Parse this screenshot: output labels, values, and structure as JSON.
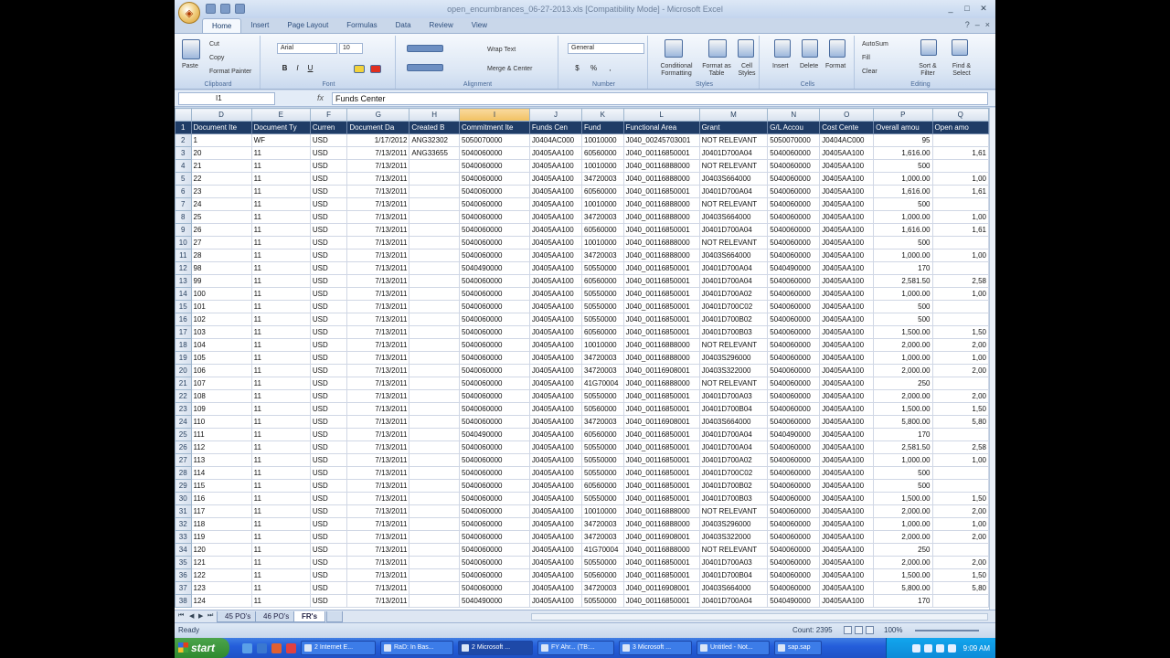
{
  "window": {
    "title": "open_encumbrances_06-27-2013.xls [Compatibility Mode] - Microsoft Excel",
    "controls": [
      "_",
      "□",
      "✕"
    ]
  },
  "ribbon_tabs": [
    "Home",
    "Insert",
    "Page Layout",
    "Formulas",
    "Data",
    "Review",
    "View"
  ],
  "ribbon": {
    "clipboard": {
      "paste": "Paste",
      "cut": "Cut",
      "copy": "Copy",
      "format_painter": "Format Painter",
      "label": "Clipboard"
    },
    "font": {
      "name": "Arial",
      "size": "10",
      "label": "Font"
    },
    "alignment": {
      "wrap": "Wrap Text",
      "merge": "Merge & Center",
      "label": "Alignment"
    },
    "number": {
      "format": "General",
      "label": "Number"
    },
    "styles": {
      "conditional": "Conditional Formatting",
      "format_table": "Format as Table",
      "cell_styles": "Cell Styles",
      "label": "Styles"
    },
    "cells": {
      "insert": "Insert",
      "delete": "Delete",
      "format": "Format",
      "label": "Cells"
    },
    "editing": {
      "autosum": "AutoSum",
      "fill": "Fill",
      "clear": "Clear",
      "sort": "Sort & Filter",
      "find": "Find & Select",
      "label": "Editing"
    }
  },
  "formula_bar": {
    "name_box": "I1",
    "fx": "fx",
    "content": "Funds Center"
  },
  "columns": [
    "D",
    "E",
    "F",
    "G",
    "H",
    "I",
    "J",
    "K",
    "L",
    "M",
    "N",
    "O",
    "P",
    "Q"
  ],
  "header_row": [
    "Document Ite",
    "Document Ty",
    "Curren",
    "Document Da",
    "Created B",
    "Commitment Ite",
    "Funds Cen",
    "Fund",
    "Functional Area",
    "Grant",
    "G/L Accou",
    "Cost Cente",
    "Overall amou",
    "Open amo"
  ],
  "rows": [
    {
      "r": "2",
      "c": [
        "1",
        "WF",
        "USD",
        "1/17/2012",
        "ANG32302",
        "5050070000",
        "J0404AC000",
        "10010000",
        "J040_00245703001",
        "NOT RELEVANT",
        "5050070000",
        "J0404AC000",
        "95",
        ""
      ]
    },
    {
      "r": "3",
      "c": [
        "20",
        "11",
        "USD",
        "7/13/2011",
        "ANG33655",
        "5040060000",
        "J0405AA100",
        "60560000",
        "J040_00116850001",
        "J0401D700A04",
        "5040060000",
        "J0405AA100",
        "1,616.00",
        "1,61"
      ]
    },
    {
      "r": "4",
      "c": [
        "21",
        "11",
        "USD",
        "7/13/2011",
        "",
        "5040060000",
        "J0405AA100",
        "10010000",
        "J040_00116888000",
        "NOT RELEVANT",
        "5040060000",
        "J0405AA100",
        "500",
        ""
      ]
    },
    {
      "r": "5",
      "c": [
        "22",
        "11",
        "USD",
        "7/13/2011",
        "",
        "5040060000",
        "J0405AA100",
        "34720003",
        "J040_00116888000",
        "J0403S664000",
        "5040060000",
        "J0405AA100",
        "1,000.00",
        "1,00"
      ]
    },
    {
      "r": "6",
      "c": [
        "23",
        "11",
        "USD",
        "7/13/2011",
        "",
        "5040060000",
        "J0405AA100",
        "60560000",
        "J040_00116850001",
        "J0401D700A04",
        "5040060000",
        "J0405AA100",
        "1,616.00",
        "1,61"
      ]
    },
    {
      "r": "7",
      "c": [
        "24",
        "11",
        "USD",
        "7/13/2011",
        "",
        "5040060000",
        "J0405AA100",
        "10010000",
        "J040_00116888000",
        "NOT RELEVANT",
        "5040060000",
        "J0405AA100",
        "500",
        ""
      ]
    },
    {
      "r": "8",
      "c": [
        "25",
        "11",
        "USD",
        "7/13/2011",
        "",
        "5040060000",
        "J0405AA100",
        "34720003",
        "J040_00116888000",
        "J0403S664000",
        "5040060000",
        "J0405AA100",
        "1,000.00",
        "1,00"
      ]
    },
    {
      "r": "9",
      "c": [
        "26",
        "11",
        "USD",
        "7/13/2011",
        "",
        "5040060000",
        "J0405AA100",
        "60560000",
        "J040_00116850001",
        "J0401D700A04",
        "5040060000",
        "J0405AA100",
        "1,616.00",
        "1,61"
      ]
    },
    {
      "r": "10",
      "c": [
        "27",
        "11",
        "USD",
        "7/13/2011",
        "",
        "5040060000",
        "J0405AA100",
        "10010000",
        "J040_00116888000",
        "NOT RELEVANT",
        "5040060000",
        "J0405AA100",
        "500",
        ""
      ]
    },
    {
      "r": "11",
      "c": [
        "28",
        "11",
        "USD",
        "7/13/2011",
        "",
        "5040060000",
        "J0405AA100",
        "34720003",
        "J040_00116888000",
        "J0403S664000",
        "5040060000",
        "J0405AA100",
        "1,000.00",
        "1,00"
      ]
    },
    {
      "r": "12",
      "c": [
        "98",
        "11",
        "USD",
        "7/13/2011",
        "",
        "5040490000",
        "J0405AA100",
        "50550000",
        "J040_00116850001",
        "J0401D700A04",
        "5040490000",
        "J0405AA100",
        "170",
        ""
      ]
    },
    {
      "r": "13",
      "c": [
        "99",
        "11",
        "USD",
        "7/13/2011",
        "",
        "5040060000",
        "J0405AA100",
        "60560000",
        "J040_00116850001",
        "J0401D700A04",
        "5040060000",
        "J0405AA100",
        "2,581.50",
        "2,58"
      ]
    },
    {
      "r": "14",
      "c": [
        "100",
        "11",
        "USD",
        "7/13/2011",
        "",
        "5040060000",
        "J0405AA100",
        "50550000",
        "J040_00116850001",
        "J0401D700A02",
        "5040060000",
        "J0405AA100",
        "1,000.00",
        "1,00"
      ]
    },
    {
      "r": "15",
      "c": [
        "101",
        "11",
        "USD",
        "7/13/2011",
        "",
        "5040060000",
        "J0405AA100",
        "50550000",
        "J040_00116850001",
        "J0401D700C02",
        "5040060000",
        "J0405AA100",
        "500",
        ""
      ]
    },
    {
      "r": "16",
      "c": [
        "102",
        "11",
        "USD",
        "7/13/2011",
        "",
        "5040060000",
        "J0405AA100",
        "50550000",
        "J040_00116850001",
        "J0401D700B02",
        "5040060000",
        "J0405AA100",
        "500",
        ""
      ]
    },
    {
      "r": "17",
      "c": [
        "103",
        "11",
        "USD",
        "7/13/2011",
        "",
        "5040060000",
        "J0405AA100",
        "60560000",
        "J040_00116850001",
        "J0401D700B03",
        "5040060000",
        "J0405AA100",
        "1,500.00",
        "1,50"
      ]
    },
    {
      "r": "18",
      "c": [
        "104",
        "11",
        "USD",
        "7/13/2011",
        "",
        "5040060000",
        "J0405AA100",
        "10010000",
        "J040_00116888000",
        "NOT RELEVANT",
        "5040060000",
        "J0405AA100",
        "2,000.00",
        "2,00"
      ]
    },
    {
      "r": "19",
      "c": [
        "105",
        "11",
        "USD",
        "7/13/2011",
        "",
        "5040060000",
        "J0405AA100",
        "34720003",
        "J040_00116888000",
        "J0403S296000",
        "5040060000",
        "J0405AA100",
        "1,000.00",
        "1,00"
      ]
    },
    {
      "r": "20",
      "c": [
        "106",
        "11",
        "USD",
        "7/13/2011",
        "",
        "5040060000",
        "J0405AA100",
        "34720003",
        "J040_00116908001",
        "J0403S322000",
        "5040060000",
        "J0405AA100",
        "2,000.00",
        "2,00"
      ]
    },
    {
      "r": "21",
      "c": [
        "107",
        "11",
        "USD",
        "7/13/2011",
        "",
        "5040060000",
        "J0405AA100",
        "41G70004",
        "J040_00116888000",
        "NOT RELEVANT",
        "5040060000",
        "J0405AA100",
        "250",
        ""
      ]
    },
    {
      "r": "22",
      "c": [
        "108",
        "11",
        "USD",
        "7/13/2011",
        "",
        "5040060000",
        "J0405AA100",
        "50550000",
        "J040_00116850001",
        "J0401D700A03",
        "5040060000",
        "J0405AA100",
        "2,000.00",
        "2,00"
      ]
    },
    {
      "r": "23",
      "c": [
        "109",
        "11",
        "USD",
        "7/13/2011",
        "",
        "5040060000",
        "J0405AA100",
        "50560000",
        "J040_00116850001",
        "J0401D700B04",
        "5040060000",
        "J0405AA100",
        "1,500.00",
        "1,50"
      ]
    },
    {
      "r": "24",
      "c": [
        "110",
        "11",
        "USD",
        "7/13/2011",
        "",
        "5040060000",
        "J0405AA100",
        "34720003",
        "J040_00116908001",
        "J0403S664000",
        "5040060000",
        "J0405AA100",
        "5,800.00",
        "5,80"
      ]
    },
    {
      "r": "25",
      "c": [
        "111",
        "11",
        "USD",
        "7/13/2011",
        "",
        "5040490000",
        "J0405AA100",
        "60560000",
        "J040_00116850001",
        "J0401D700A04",
        "5040490000",
        "J0405AA100",
        "170",
        ""
      ]
    },
    {
      "r": "26",
      "c": [
        "112",
        "11",
        "USD",
        "7/13/2011",
        "",
        "5040060000",
        "J0405AA100",
        "50550000",
        "J040_00116850001",
        "J0401D700A04",
        "5040060000",
        "J0405AA100",
        "2,581.50",
        "2,58"
      ]
    },
    {
      "r": "27",
      "c": [
        "113",
        "11",
        "USD",
        "7/13/2011",
        "",
        "5040060000",
        "J0405AA100",
        "50550000",
        "J040_00116850001",
        "J0401D700A02",
        "5040060000",
        "J0405AA100",
        "1,000.00",
        "1,00"
      ]
    },
    {
      "r": "28",
      "c": [
        "114",
        "11",
        "USD",
        "7/13/2011",
        "",
        "5040060000",
        "J0405AA100",
        "50550000",
        "J040_00116850001",
        "J0401D700C02",
        "5040060000",
        "J0405AA100",
        "500",
        ""
      ]
    },
    {
      "r": "29",
      "c": [
        "115",
        "11",
        "USD",
        "7/13/2011",
        "",
        "5040060000",
        "J0405AA100",
        "60560000",
        "J040_00116850001",
        "J0401D700B02",
        "5040060000",
        "J0405AA100",
        "500",
        ""
      ]
    },
    {
      "r": "30",
      "c": [
        "116",
        "11",
        "USD",
        "7/13/2011",
        "",
        "5040060000",
        "J0405AA100",
        "50550000",
        "J040_00116850001",
        "J0401D700B03",
        "5040060000",
        "J0405AA100",
        "1,500.00",
        "1,50"
      ]
    },
    {
      "r": "31",
      "c": [
        "117",
        "11",
        "USD",
        "7/13/2011",
        "",
        "5040060000",
        "J0405AA100",
        "10010000",
        "J040_00116888000",
        "NOT RELEVANT",
        "5040060000",
        "J0405AA100",
        "2,000.00",
        "2,00"
      ]
    },
    {
      "r": "32",
      "c": [
        "118",
        "11",
        "USD",
        "7/13/2011",
        "",
        "5040060000",
        "J0405AA100",
        "34720003",
        "J040_00116888000",
        "J0403S296000",
        "5040060000",
        "J0405AA100",
        "1,000.00",
        "1,00"
      ]
    },
    {
      "r": "33",
      "c": [
        "119",
        "11",
        "USD",
        "7/13/2011",
        "",
        "5040060000",
        "J0405AA100",
        "34720003",
        "J040_00116908001",
        "J0403S322000",
        "5040060000",
        "J0405AA100",
        "2,000.00",
        "2,00"
      ]
    },
    {
      "r": "34",
      "c": [
        "120",
        "11",
        "USD",
        "7/13/2011",
        "",
        "5040060000",
        "J0405AA100",
        "41G70004",
        "J040_00116888000",
        "NOT RELEVANT",
        "5040060000",
        "J0405AA100",
        "250",
        ""
      ]
    },
    {
      "r": "35",
      "c": [
        "121",
        "11",
        "USD",
        "7/13/2011",
        "",
        "5040060000",
        "J0405AA100",
        "50550000",
        "J040_00116850001",
        "J0401D700A03",
        "5040060000",
        "J0405AA100",
        "2,000.00",
        "2,00"
      ]
    },
    {
      "r": "36",
      "c": [
        "122",
        "11",
        "USD",
        "7/13/2011",
        "",
        "5040060000",
        "J0405AA100",
        "50560000",
        "J040_00116850001",
        "J0401D700B04",
        "5040060000",
        "J0405AA100",
        "1,500.00",
        "1,50"
      ]
    },
    {
      "r": "37",
      "c": [
        "123",
        "11",
        "USD",
        "7/13/2011",
        "",
        "5040060000",
        "J0405AA100",
        "34720003",
        "J040_00116908001",
        "J0403S664000",
        "5040060000",
        "J0405AA100",
        "5,800.00",
        "5,80"
      ]
    },
    {
      "r": "38",
      "c": [
        "124",
        "11",
        "USD",
        "7/13/2011",
        "",
        "5040490000",
        "J0405AA100",
        "50550000",
        "J040_00116850001",
        "J0401D700A04",
        "5040490000",
        "J0405AA100",
        "170",
        ""
      ]
    }
  ],
  "sheet_tabs": [
    "45 PO's",
    "46 PO's",
    "FR's"
  ],
  "active_sheet": "FR's",
  "status": {
    "ready": "Ready",
    "count": "Count: 2395",
    "zoom": "100%"
  },
  "taskbar": {
    "start": "start",
    "tasks": [
      "2 Internet E...",
      "RaD: In Bas...",
      "2 Microsoft ...",
      "FY Ahr... (TB:...",
      "3 Microsoft ...",
      "Untitled - Not...",
      "sap.sap"
    ],
    "clock": "9:09 AM"
  }
}
